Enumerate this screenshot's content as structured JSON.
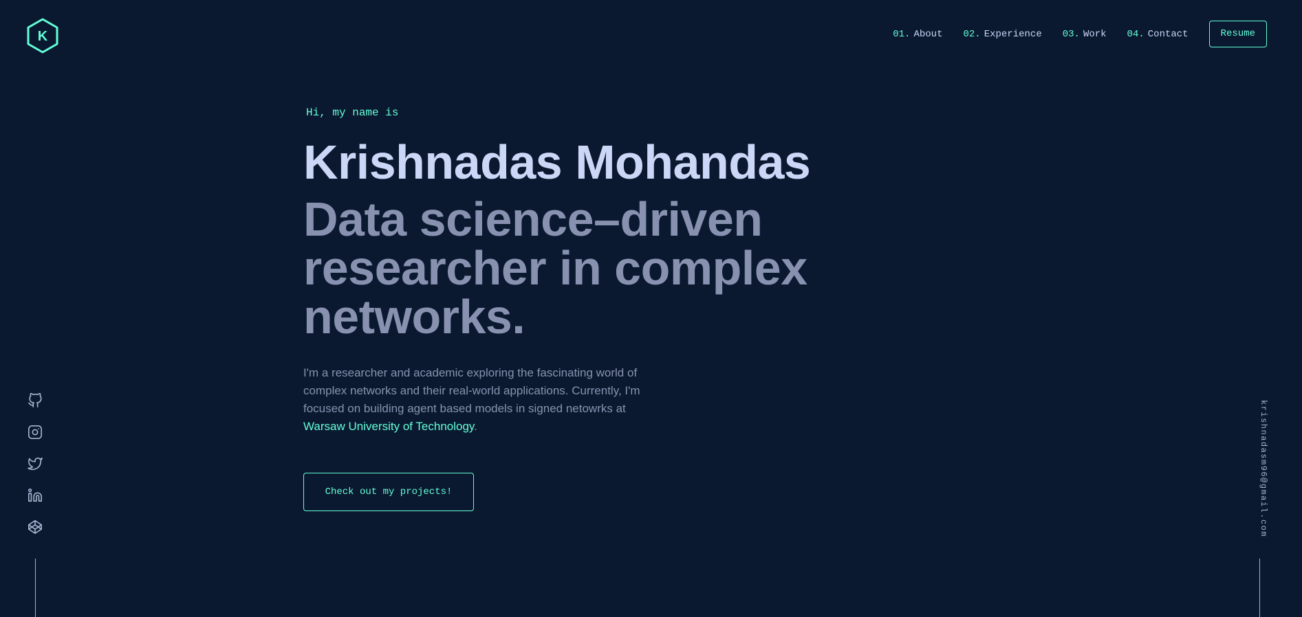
{
  "header": {
    "logo_letter": "K",
    "nav": [
      {
        "num": "01.",
        "label": "About"
      },
      {
        "num": "02.",
        "label": "Experience"
      },
      {
        "num": "03.",
        "label": "Work"
      },
      {
        "num": "04.",
        "label": "Contact"
      }
    ],
    "resume_label": "Resume"
  },
  "hero": {
    "greeting": "Hi, my name is",
    "name": "Krishnadas Mohandas",
    "tagline": "Data science–driven researcher in complex networks.",
    "intro_text": "I'm a researcher and academic exploring the fascinating world of complex networks and their real-world applications. Currently, I'm focused on building agent based models in signed netowrks at ",
    "intro_link": "Warsaw University of Technology",
    "intro_end": ".",
    "cta_label": "Check out my projects!"
  },
  "socials": [
    {
      "icon": "github-icon"
    },
    {
      "icon": "instagram-icon"
    },
    {
      "icon": "twitter-icon"
    },
    {
      "icon": "linkedin-icon"
    },
    {
      "icon": "codepen-icon"
    }
  ],
  "email": "krishnadasm96@gmail.com",
  "colors": {
    "background": "#0a192f",
    "accent": "#64ffda",
    "heading": "#ccd6f6",
    "text": "#8892b0",
    "light": "#a8b2d1"
  }
}
